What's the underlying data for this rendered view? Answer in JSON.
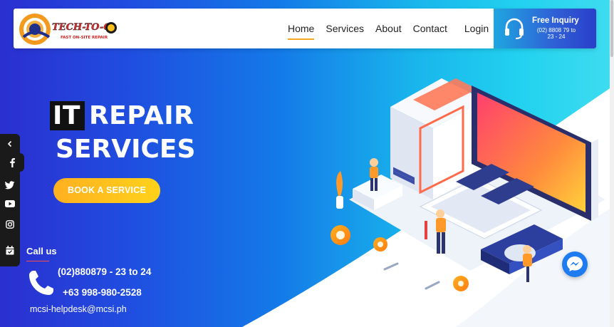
{
  "header": {
    "logo_text": "TECH-TO-GO",
    "logo_tagline": "FAST ON-SITE REPAIR",
    "nav": [
      {
        "label": "Home",
        "active": true
      },
      {
        "label": "Services",
        "active": false
      },
      {
        "label": "About",
        "active": false
      },
      {
        "label": "Contact",
        "active": false
      },
      {
        "label": "Login",
        "active": false
      }
    ],
    "inquiry": {
      "title": "Free Inquiry",
      "number": "(02) 8808 79 to 23 - 24",
      "icon": "headset-icon"
    }
  },
  "hero": {
    "headline_highlight": "IT",
    "headline_rest": "REPAIR",
    "headline_line2": "SERVICES",
    "cta_label": "BOOK A SERVICE"
  },
  "social": {
    "icons": [
      "chevron-left-icon",
      "facebook-icon",
      "twitter-icon",
      "youtube-icon",
      "instagram-icon",
      "calendar-check-icon"
    ]
  },
  "contact": {
    "call_label": "Call us",
    "phone1": "(02)880879 - 23 to 24",
    "phone2": "+63 998-980-2528",
    "email": "mcsi-helpdesk@mcsi.ph"
  },
  "colors": {
    "gradient_start": "#2b2fd0",
    "gradient_end": "#3fdcf0",
    "cta": "#ffc21e",
    "nav_active_underline": "#f5a623",
    "messenger": "#1e7bf0"
  }
}
